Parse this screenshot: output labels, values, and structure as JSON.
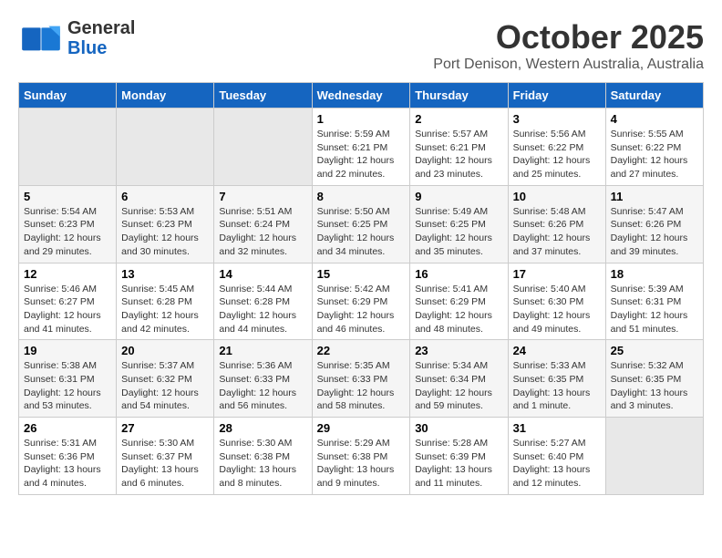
{
  "header": {
    "logo_line1": "General",
    "logo_line2": "Blue",
    "month": "October 2025",
    "location": "Port Denison, Western Australia, Australia"
  },
  "days_of_week": [
    "Sunday",
    "Monday",
    "Tuesday",
    "Wednesday",
    "Thursday",
    "Friday",
    "Saturday"
  ],
  "weeks": [
    [
      {
        "num": "",
        "info": ""
      },
      {
        "num": "",
        "info": ""
      },
      {
        "num": "",
        "info": ""
      },
      {
        "num": "1",
        "info": "Sunrise: 5:59 AM\nSunset: 6:21 PM\nDaylight: 12 hours\nand 22 minutes."
      },
      {
        "num": "2",
        "info": "Sunrise: 5:57 AM\nSunset: 6:21 PM\nDaylight: 12 hours\nand 23 minutes."
      },
      {
        "num": "3",
        "info": "Sunrise: 5:56 AM\nSunset: 6:22 PM\nDaylight: 12 hours\nand 25 minutes."
      },
      {
        "num": "4",
        "info": "Sunrise: 5:55 AM\nSunset: 6:22 PM\nDaylight: 12 hours\nand 27 minutes."
      }
    ],
    [
      {
        "num": "5",
        "info": "Sunrise: 5:54 AM\nSunset: 6:23 PM\nDaylight: 12 hours\nand 29 minutes."
      },
      {
        "num": "6",
        "info": "Sunrise: 5:53 AM\nSunset: 6:23 PM\nDaylight: 12 hours\nand 30 minutes."
      },
      {
        "num": "7",
        "info": "Sunrise: 5:51 AM\nSunset: 6:24 PM\nDaylight: 12 hours\nand 32 minutes."
      },
      {
        "num": "8",
        "info": "Sunrise: 5:50 AM\nSunset: 6:25 PM\nDaylight: 12 hours\nand 34 minutes."
      },
      {
        "num": "9",
        "info": "Sunrise: 5:49 AM\nSunset: 6:25 PM\nDaylight: 12 hours\nand 35 minutes."
      },
      {
        "num": "10",
        "info": "Sunrise: 5:48 AM\nSunset: 6:26 PM\nDaylight: 12 hours\nand 37 minutes."
      },
      {
        "num": "11",
        "info": "Sunrise: 5:47 AM\nSunset: 6:26 PM\nDaylight: 12 hours\nand 39 minutes."
      }
    ],
    [
      {
        "num": "12",
        "info": "Sunrise: 5:46 AM\nSunset: 6:27 PM\nDaylight: 12 hours\nand 41 minutes."
      },
      {
        "num": "13",
        "info": "Sunrise: 5:45 AM\nSunset: 6:28 PM\nDaylight: 12 hours\nand 42 minutes."
      },
      {
        "num": "14",
        "info": "Sunrise: 5:44 AM\nSunset: 6:28 PM\nDaylight: 12 hours\nand 44 minutes."
      },
      {
        "num": "15",
        "info": "Sunrise: 5:42 AM\nSunset: 6:29 PM\nDaylight: 12 hours\nand 46 minutes."
      },
      {
        "num": "16",
        "info": "Sunrise: 5:41 AM\nSunset: 6:29 PM\nDaylight: 12 hours\nand 48 minutes."
      },
      {
        "num": "17",
        "info": "Sunrise: 5:40 AM\nSunset: 6:30 PM\nDaylight: 12 hours\nand 49 minutes."
      },
      {
        "num": "18",
        "info": "Sunrise: 5:39 AM\nSunset: 6:31 PM\nDaylight: 12 hours\nand 51 minutes."
      }
    ],
    [
      {
        "num": "19",
        "info": "Sunrise: 5:38 AM\nSunset: 6:31 PM\nDaylight: 12 hours\nand 53 minutes."
      },
      {
        "num": "20",
        "info": "Sunrise: 5:37 AM\nSunset: 6:32 PM\nDaylight: 12 hours\nand 54 minutes."
      },
      {
        "num": "21",
        "info": "Sunrise: 5:36 AM\nSunset: 6:33 PM\nDaylight: 12 hours\nand 56 minutes."
      },
      {
        "num": "22",
        "info": "Sunrise: 5:35 AM\nSunset: 6:33 PM\nDaylight: 12 hours\nand 58 minutes."
      },
      {
        "num": "23",
        "info": "Sunrise: 5:34 AM\nSunset: 6:34 PM\nDaylight: 12 hours\nand 59 minutes."
      },
      {
        "num": "24",
        "info": "Sunrise: 5:33 AM\nSunset: 6:35 PM\nDaylight: 13 hours\nand 1 minute."
      },
      {
        "num": "25",
        "info": "Sunrise: 5:32 AM\nSunset: 6:35 PM\nDaylight: 13 hours\nand 3 minutes."
      }
    ],
    [
      {
        "num": "26",
        "info": "Sunrise: 5:31 AM\nSunset: 6:36 PM\nDaylight: 13 hours\nand 4 minutes."
      },
      {
        "num": "27",
        "info": "Sunrise: 5:30 AM\nSunset: 6:37 PM\nDaylight: 13 hours\nand 6 minutes."
      },
      {
        "num": "28",
        "info": "Sunrise: 5:30 AM\nSunset: 6:38 PM\nDaylight: 13 hours\nand 8 minutes."
      },
      {
        "num": "29",
        "info": "Sunrise: 5:29 AM\nSunset: 6:38 PM\nDaylight: 13 hours\nand 9 minutes."
      },
      {
        "num": "30",
        "info": "Sunrise: 5:28 AM\nSunset: 6:39 PM\nDaylight: 13 hours\nand 11 minutes."
      },
      {
        "num": "31",
        "info": "Sunrise: 5:27 AM\nSunset: 6:40 PM\nDaylight: 13 hours\nand 12 minutes."
      },
      {
        "num": "",
        "info": ""
      }
    ]
  ]
}
